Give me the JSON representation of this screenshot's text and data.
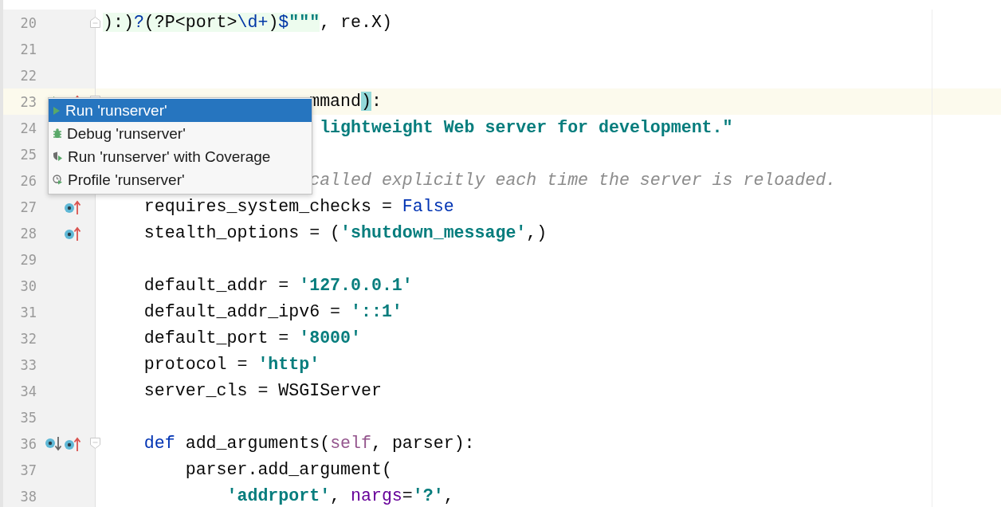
{
  "editor": {
    "lines": [
      {
        "number": "20",
        "current": false,
        "fold": {
          "kind": "end"
        },
        "tokens": [
          {
            "text": "):)",
            "kind": "plain",
            "injected": true
          },
          {
            "text": "?",
            "kind": "regex",
            "injected": true
          },
          {
            "text": "(?P<port>",
            "kind": "plain",
            "injected": true
          },
          {
            "text": "\\d+",
            "kind": "regex",
            "injected": true
          },
          {
            "text": ")",
            "kind": "plain",
            "injected": true
          },
          {
            "text": "$",
            "kind": "regex",
            "injected": true
          },
          {
            "text": "\"\"\"",
            "kind": "string",
            "injected": true
          },
          {
            "text": ", re.X)",
            "kind": "plain",
            "injected": false
          }
        ]
      },
      {
        "number": "21",
        "current": false
      },
      {
        "number": "22",
        "current": false
      },
      {
        "number": "23",
        "current": true,
        "fold": {
          "kind": "start"
        },
        "markers": [
          {
            "kind": "run"
          },
          {
            "kind": "overrides"
          }
        ],
        "tokens": [
          {
            "text": "                    mmand",
            "kind": "plain",
            "injected": false
          },
          {
            "text": ")",
            "kind": "brace",
            "injected": false
          },
          {
            "text": ":",
            "kind": "plain",
            "injected": false
          }
        ]
      },
      {
        "number": "24",
        "current": false,
        "tokens": [
          {
            "text": "                     lightweight Web server for development.\"",
            "kind": "string",
            "injected": false
          }
        ]
      },
      {
        "number": "25",
        "current": false
      },
      {
        "number": "26",
        "current": false,
        "tokens": [
          {
            "text": "                    called explicitly each time the server is reloaded.",
            "kind": "comment",
            "injected": false
          }
        ]
      },
      {
        "number": "27",
        "current": false,
        "markers": [
          {
            "kind": "overrides"
          }
        ],
        "tokens": [
          {
            "text": "    requires_system_checks = ",
            "kind": "plain",
            "injected": false
          },
          {
            "text": "False",
            "kind": "keyword",
            "injected": false
          }
        ]
      },
      {
        "number": "28",
        "current": false,
        "markers": [
          {
            "kind": "overrides"
          }
        ],
        "tokens": [
          {
            "text": "    stealth_options = (",
            "kind": "plain",
            "injected": false
          },
          {
            "text": "'shutdown_message'",
            "kind": "string",
            "injected": false
          },
          {
            "text": ",)",
            "kind": "plain",
            "injected": false
          }
        ]
      },
      {
        "number": "29",
        "current": false
      },
      {
        "number": "30",
        "current": false,
        "tokens": [
          {
            "text": "    default_addr = ",
            "kind": "plain",
            "injected": false
          },
          {
            "text": "'127.0.0.1'",
            "kind": "string",
            "injected": false
          }
        ]
      },
      {
        "number": "31",
        "current": false,
        "tokens": [
          {
            "text": "    default_addr_ipv6 = ",
            "kind": "plain",
            "injected": false
          },
          {
            "text": "'::1'",
            "kind": "string",
            "injected": false
          }
        ]
      },
      {
        "number": "32",
        "current": false,
        "tokens": [
          {
            "text": "    default_port = ",
            "kind": "plain",
            "injected": false
          },
          {
            "text": "'8000'",
            "kind": "string",
            "injected": false
          }
        ]
      },
      {
        "number": "33",
        "current": false,
        "tokens": [
          {
            "text": "    protocol = ",
            "kind": "plain",
            "injected": false
          },
          {
            "text": "'http'",
            "kind": "string",
            "injected": false
          }
        ]
      },
      {
        "number": "34",
        "current": false,
        "tokens": [
          {
            "text": "    server_cls = WSGIServer",
            "kind": "plain",
            "injected": false
          }
        ]
      },
      {
        "number": "35",
        "current": false
      },
      {
        "number": "36",
        "current": false,
        "fold": {
          "kind": "start"
        },
        "markers": [
          {
            "kind": "overridden"
          },
          {
            "kind": "overrides"
          }
        ],
        "tokens": [
          {
            "text": "    def",
            "kind": "keyword",
            "injected": false
          },
          {
            "text": " add_arguments(",
            "kind": "plain",
            "injected": false
          },
          {
            "text": "self",
            "kind": "self",
            "injected": false
          },
          {
            "text": ", parser):",
            "kind": "plain",
            "injected": false
          }
        ]
      },
      {
        "number": "37",
        "current": false,
        "tokens": [
          {
            "text": "        parser.add_argument(",
            "kind": "plain",
            "injected": false
          }
        ]
      },
      {
        "number": "38",
        "current": false,
        "tokens": [
          {
            "text": "            'addrport'",
            "kind": "string",
            "injected": false
          },
          {
            "text": ", ",
            "kind": "plain",
            "injected": false
          },
          {
            "text": "nargs",
            "kind": "param",
            "injected": false
          },
          {
            "text": "=",
            "kind": "plain",
            "injected": false
          },
          {
            "text": "'?'",
            "kind": "string",
            "injected": false
          },
          {
            "text": ",",
            "kind": "plain",
            "injected": false
          }
        ]
      }
    ]
  },
  "popup": {
    "items": [
      {
        "label": "Run 'runserver'",
        "kind": "run",
        "selected": true
      },
      {
        "label": "Debug 'runserver'",
        "kind": "debug",
        "selected": false
      },
      {
        "label": "Run 'runserver' with Coverage",
        "kind": "coverage",
        "selected": false
      },
      {
        "label": "Profile 'runserver'",
        "kind": "profile",
        "selected": false
      }
    ]
  }
}
